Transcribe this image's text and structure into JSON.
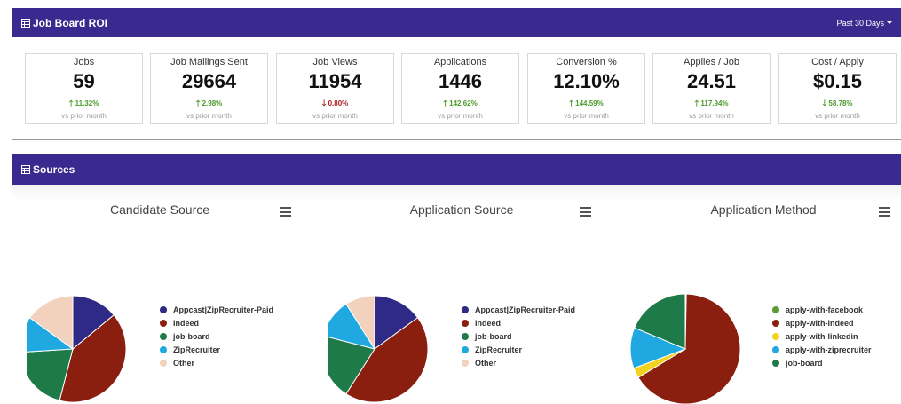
{
  "header": {
    "title": "Job Board ROI",
    "range_label": "Past 30 Days"
  },
  "stats": [
    {
      "label": "Jobs",
      "value": "59",
      "change": "11.32%",
      "direction": "up",
      "sub": "vs prior month"
    },
    {
      "label": "Job Mailings Sent",
      "value": "29664",
      "change": "2.98%",
      "direction": "up",
      "sub": "vs prior month"
    },
    {
      "label": "Job Views",
      "value": "11954",
      "change": "0.80%",
      "direction": "down",
      "sub": "vs prior month"
    },
    {
      "label": "Applications",
      "value": "1446",
      "change": "142.62%",
      "direction": "up",
      "sub": "vs prior month"
    },
    {
      "label": "Conversion %",
      "value": "12.10%",
      "change": "144.59%",
      "direction": "up",
      "sub": "vs prior month"
    },
    {
      "label": "Applies / Job",
      "value": "24.51",
      "change": "117.94%",
      "direction": "up",
      "sub": "vs prior month"
    },
    {
      "label": "Cost / Apply",
      "value": "$0.15",
      "change": "58.78%",
      "direction": "down_good",
      "sub": "vs prior month"
    }
  ],
  "sources": {
    "title": "Sources"
  },
  "chart_data": [
    {
      "type": "pie",
      "title": "Candidate Source",
      "categories": [
        "Appcast|ZipRecruiter-Paid",
        "Indeed",
        "job-board",
        "ZipRecruiter",
        "Other"
      ],
      "values": [
        14,
        40,
        20,
        11,
        15
      ],
      "colors": [
        "#2e2a86",
        "#8a1f0f",
        "#1f7a4a",
        "#1fa9e0",
        "#f2d2bd"
      ]
    },
    {
      "type": "pie",
      "title": "Application Source",
      "categories": [
        "Appcast|ZipRecruiter-Paid",
        "Indeed",
        "job-board",
        "ZipRecruiter",
        "Other"
      ],
      "values": [
        15,
        44,
        20,
        12,
        9
      ],
      "colors": [
        "#2e2a86",
        "#8a1f0f",
        "#1f7a4a",
        "#1fa9e0",
        "#f2d2bd"
      ]
    },
    {
      "type": "pie",
      "title": "Application Method",
      "categories": [
        "apply-with-facebook",
        "apply-with-indeed",
        "apply-with-linkedin",
        "apply-with-ziprecruiter",
        "job-board"
      ],
      "values": [
        0.3,
        66,
        3,
        12,
        18.7
      ],
      "colors": [
        "#5a9e32",
        "#8a1f0f",
        "#f2d21e",
        "#1fa9e0",
        "#1f7a4a"
      ]
    }
  ]
}
